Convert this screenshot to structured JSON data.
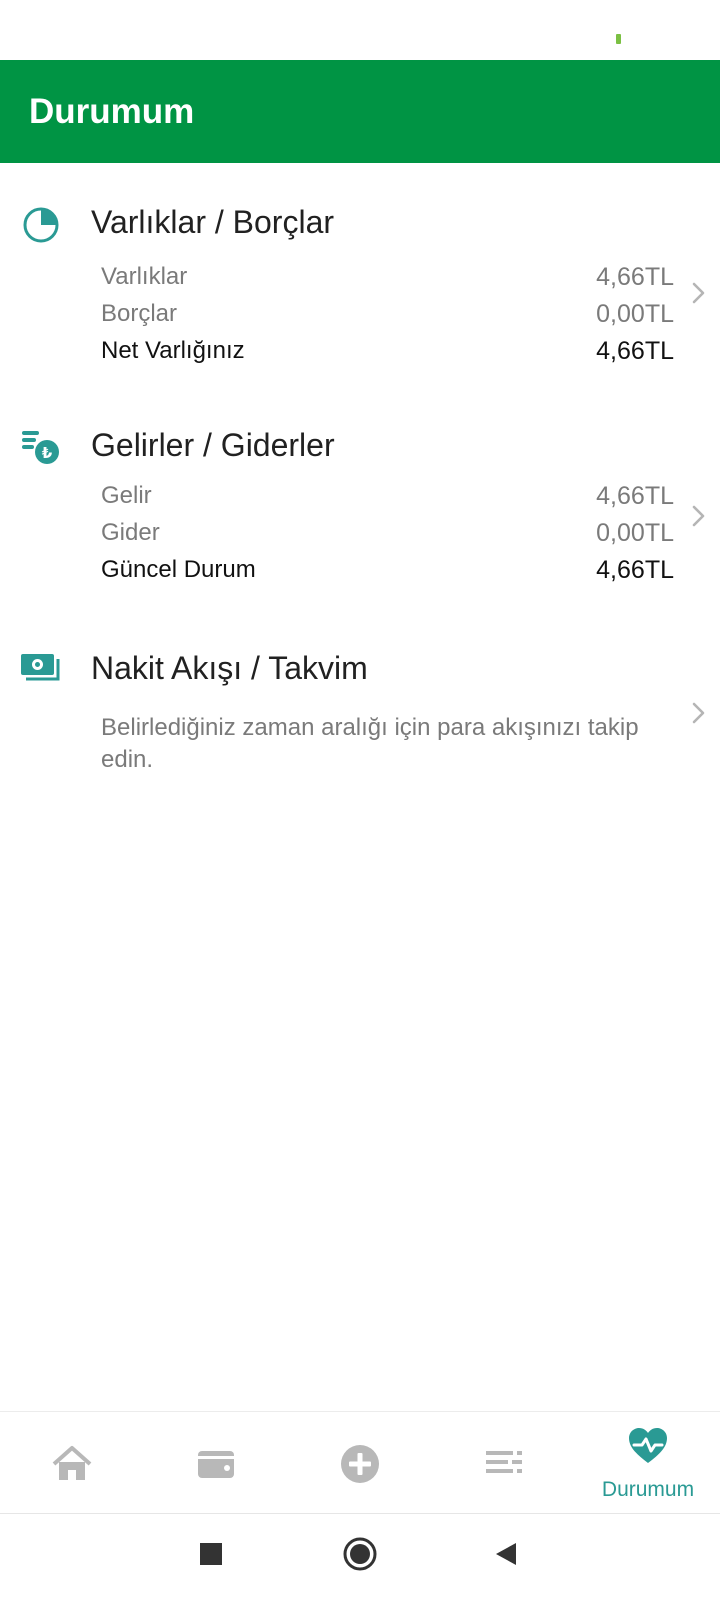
{
  "header": {
    "title": "Durumum"
  },
  "sections": {
    "assets": {
      "title": "Varlıklar / Borçlar",
      "icon": "pie-chart-icon",
      "rows": [
        {
          "label": "Varlıklar",
          "value": "4,66TL"
        },
        {
          "label": "Borçlar",
          "value": "0,00TL"
        },
        {
          "label": "Net Varlığınız",
          "value": "4,66TL"
        }
      ]
    },
    "income": {
      "title": "Gelirler / Giderler",
      "icon": "coins-lira-icon",
      "rows": [
        {
          "label": "Gelir",
          "value": "4,66TL"
        },
        {
          "label": "Gider",
          "value": "0,00TL"
        },
        {
          "label": "Güncel Durum",
          "value": "4,66TL"
        }
      ]
    },
    "cashflow": {
      "title": "Nakit Akışı / Takvim",
      "icon": "banknote-icon",
      "description": "Belirlediğiniz zaman aralığı için para akışınızı takip edin."
    }
  },
  "bottom_nav": {
    "items": [
      {
        "icon": "home-icon",
        "label": ""
      },
      {
        "icon": "wallet-icon",
        "label": ""
      },
      {
        "icon": "add-circle-icon",
        "label": ""
      },
      {
        "icon": "list-icon",
        "label": ""
      },
      {
        "icon": "heart-pulse-icon",
        "label": "Durumum",
        "active": true
      }
    ]
  },
  "colors": {
    "app_bar": "#009444",
    "accent": "#2a9a94",
    "nav_inactive": "#b8b8b8"
  }
}
